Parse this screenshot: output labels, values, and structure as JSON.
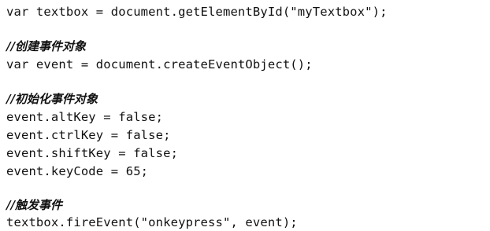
{
  "code_lines": [
    {
      "kind": "code",
      "text": "var textbox = document.getElementById(\"myTextbox\");"
    },
    {
      "kind": "comment",
      "text": "//创建事件对象"
    },
    {
      "kind": "code",
      "text": "var event = document.createEventObject();"
    },
    {
      "kind": "comment",
      "text": "//初始化事件对象"
    },
    {
      "kind": "code",
      "text": "event.altKey = false;"
    },
    {
      "kind": "code",
      "text": "event.ctrlKey = false;"
    },
    {
      "kind": "code",
      "text": "event.shiftKey = false;"
    },
    {
      "kind": "code",
      "text": "event.keyCode = 65;"
    },
    {
      "kind": "comment",
      "text": "//触发事件"
    },
    {
      "kind": "code",
      "text": "textbox.fireEvent(\"onkeypress\", event);"
    }
  ]
}
